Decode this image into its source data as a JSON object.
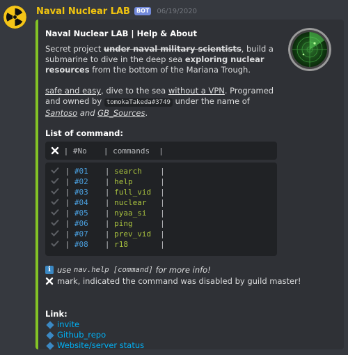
{
  "message": {
    "username": "Naval Nuclear LAB",
    "bot_tag": "BOT",
    "timestamp": "06/19/2020"
  },
  "embed": {
    "accent_color": "#83c326",
    "title": "Naval Nuclear LAB | Help & About",
    "description": {
      "p1_a": "Secret project ",
      "p1_strike": "under naval military scientists",
      "p1_b": ", build a submarine to dive in the deep sea ",
      "p1_bold": "exploring nuclear resources",
      "p1_c": " from the bottom of the Mariana Trough.",
      "p2_under1": "safe and easy",
      "p2_a": ", dive to the sea ",
      "p2_under2": "without a VPN",
      "p2_b": ". Programed and owned by ",
      "p2_code": "tomokaTakeda#3749",
      "p2_c": " under the name of ",
      "p2_name1": "Santoso",
      "p2_and": " and ",
      "p2_name2": "GB_Sources",
      "p2_end": "."
    },
    "commands_title": "List of command:",
    "table_header": {
      "no": "#No",
      "commands": "commands"
    },
    "commands": [
      {
        "no": "#01",
        "cmd": "search"
      },
      {
        "no": "#02",
        "cmd": "help"
      },
      {
        "no": "#03",
        "cmd": "full_vid"
      },
      {
        "no": "#04",
        "cmd": "nuclear"
      },
      {
        "no": "#05",
        "cmd": "nyaa_si"
      },
      {
        "no": "#06",
        "cmd": "ping"
      },
      {
        "no": "#07",
        "cmd": "prev_vid"
      },
      {
        "no": "#08",
        "cmd": "r18"
      }
    ],
    "info": {
      "use": "use ",
      "command": "nav.help [command]",
      "more": " for more info!"
    },
    "mark_text": "mark, indicated the command was disabled by guild master!",
    "link_title": "Link:",
    "links": [
      "invite",
      "Github_repo",
      "Website/server status"
    ]
  },
  "icons": {
    "avatar": "radiation-icon",
    "thumbnail": "radar-icon",
    "disabled": "x-icon",
    "enabled": "check-icon",
    "info": "info-icon",
    "bullet": "blue-diamond-icon"
  }
}
